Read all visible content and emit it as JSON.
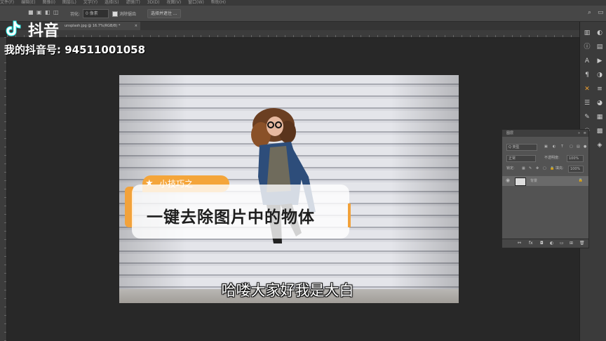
{
  "menubar": {
    "items": [
      "文件(F)",
      "编辑(E)",
      "图像(I)",
      "图层(L)",
      "文字(Y)",
      "选择(S)",
      "滤镜(T)",
      "3D(D)",
      "视图(V)",
      "窗口(W)",
      "帮助(H)"
    ]
  },
  "options": {
    "feather_label": "羽化:",
    "feather_value": "0 像素",
    "antialias_label": "消除锯齿",
    "select_subject_button": "选择并遮住 ..."
  },
  "document": {
    "tab_title": "unsplash.jpg @ 16.7%(RGB/8) *"
  },
  "layers_panel": {
    "title": "图层",
    "filter_label": "Q 类型",
    "blend_mode": "正常",
    "opacity_label": "不透明度:",
    "opacity_value": "100%",
    "lock_label": "锁定:",
    "fill_label": "填充:",
    "fill_value": "100%",
    "layer_name": "背景",
    "footer_icons": [
      "link-icon",
      "fx-icon",
      "mask-icon",
      "adjustment-icon",
      "group-icon",
      "new-layer-icon",
      "trash-icon"
    ]
  },
  "overlay": {
    "douyin_brand": "抖音",
    "douyin_id": "我的抖音号: 94511001058",
    "tip_tag": "小技巧之",
    "tip_title": "一键去除图片中的物体",
    "subtitle": "哈喽大家好我是大白"
  },
  "colors": {
    "accent_orange": "#f4a53a",
    "app_background": "#282828",
    "panel_gray": "#535353"
  }
}
